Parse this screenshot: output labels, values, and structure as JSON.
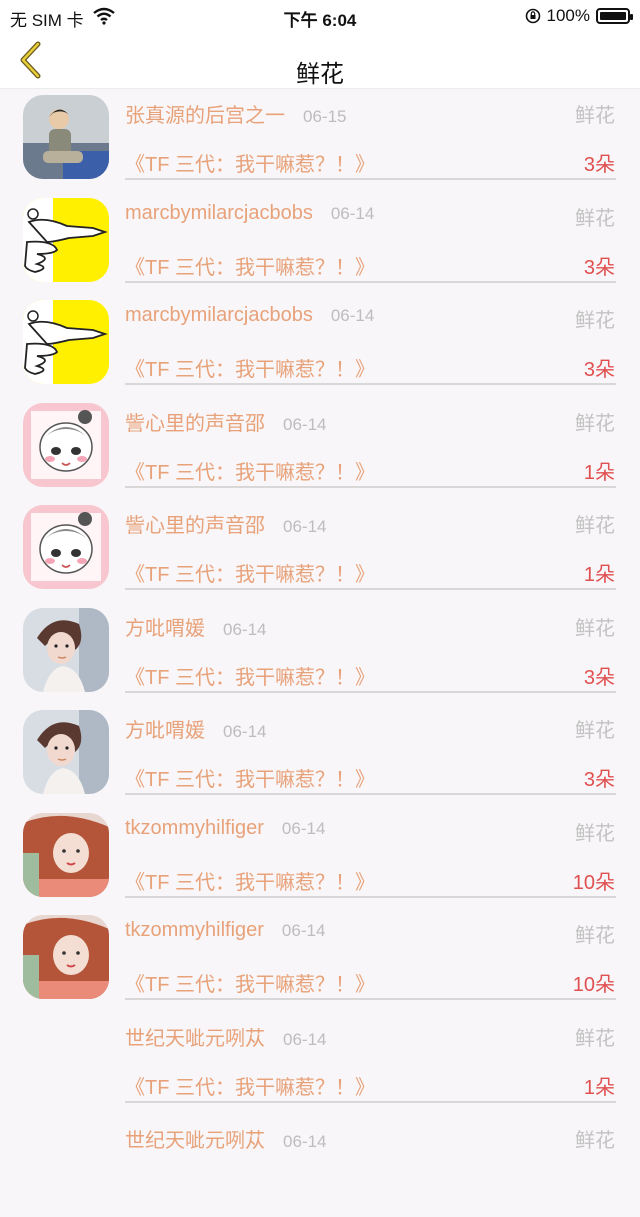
{
  "status": {
    "carrier": "无 SIM 卡",
    "time": "下午 6:04",
    "battery_text": "100%",
    "battery_level": 1.0
  },
  "nav": {
    "title": "鲜花"
  },
  "rows": [
    {
      "name": "张真源的后宫之一",
      "date": "06-15",
      "gift": "鲜花",
      "book": "《TF 三代：我干嘛惹？！》",
      "count": "3朵",
      "avatar": "photo-boy-sitting"
    },
    {
      "name": "marcbymilarcjacbobs",
      "date": "06-14",
      "gift": "鲜花",
      "book": "《TF 三代：我干嘛惹？！》",
      "count": "3朵",
      "avatar": "hand-gun-yellow"
    },
    {
      "name": "marcbymilarcjacbobs",
      "date": "06-14",
      "gift": "鲜花",
      "book": "《TF 三代：我干嘛惹？！》",
      "count": "3朵",
      "avatar": "hand-gun-yellow"
    },
    {
      "name": "訾心里的声音邵",
      "date": "06-14",
      "gift": "鲜花",
      "book": "《TF 三代：我干嘛惹？！》",
      "count": "1朵",
      "avatar": "cartoon-girl-pink"
    },
    {
      "name": "訾心里的声音邵",
      "date": "06-14",
      "gift": "鲜花",
      "book": "《TF 三代：我干嘛惹？！》",
      "count": "1朵",
      "avatar": "cartoon-girl-pink"
    },
    {
      "name": "方吡喟媛",
      "date": "06-14",
      "gift": "鲜花",
      "book": "《TF 三代：我干嘛惹？！》",
      "count": "3朵",
      "avatar": "photo-woman-shorthair"
    },
    {
      "name": "方吡喟媛",
      "date": "06-14",
      "gift": "鲜花",
      "book": "《TF 三代：我干嘛惹？！》",
      "count": "3朵",
      "avatar": "photo-woman-shorthair"
    },
    {
      "name": "tkzommyhilfiger",
      "date": "06-14",
      "gift": "鲜花",
      "book": "《TF 三代：我干嘛惹？！》",
      "count": "10朵",
      "avatar": "photo-woman-redhair"
    },
    {
      "name": "tkzommyhilfiger",
      "date": "06-14",
      "gift": "鲜花",
      "book": "《TF 三代：我干嘛惹？！》",
      "count": "10朵",
      "avatar": "photo-woman-redhair"
    },
    {
      "name": "世纪天呲元咧苁",
      "date": "06-14",
      "gift": "鲜花",
      "book": "《TF 三代：我干嘛惹？！》",
      "count": "1朵",
      "avatar": ""
    },
    {
      "name": "世纪天呲元咧苁",
      "date": "06-14",
      "gift": "鲜花",
      "book": "",
      "count": "",
      "avatar": ""
    }
  ]
}
